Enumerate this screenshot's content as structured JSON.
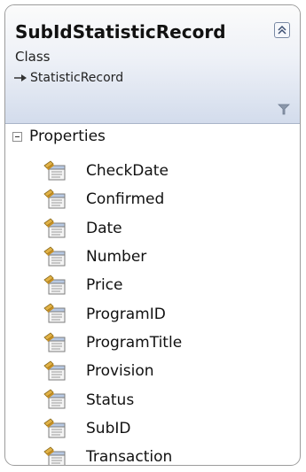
{
  "class": {
    "name": "SubIdStatisticRecord",
    "stereotype": "Class",
    "base_class": "StatisticRecord",
    "icons": {
      "collapse": "double-chevron-up-icon",
      "filter": "filter-funnel-icon",
      "inherit": "inheritance-arrow-icon",
      "property": "property-icon"
    }
  },
  "section": {
    "title": "Properties",
    "toggle_icon": "collapse-minus-icon"
  },
  "properties": [
    {
      "label": "CheckDate"
    },
    {
      "label": "Confirmed"
    },
    {
      "label": "Date"
    },
    {
      "label": "Number"
    },
    {
      "label": "Price"
    },
    {
      "label": "ProgramID"
    },
    {
      "label": "ProgramTitle"
    },
    {
      "label": "Provision"
    },
    {
      "label": "Status"
    },
    {
      "label": "SubID"
    },
    {
      "label": "Transaction"
    }
  ],
  "colors": {
    "header_gradient_top": "#fbfbfb",
    "header_gradient_bottom": "#d3dcec",
    "border": "#9c9c9c"
  }
}
